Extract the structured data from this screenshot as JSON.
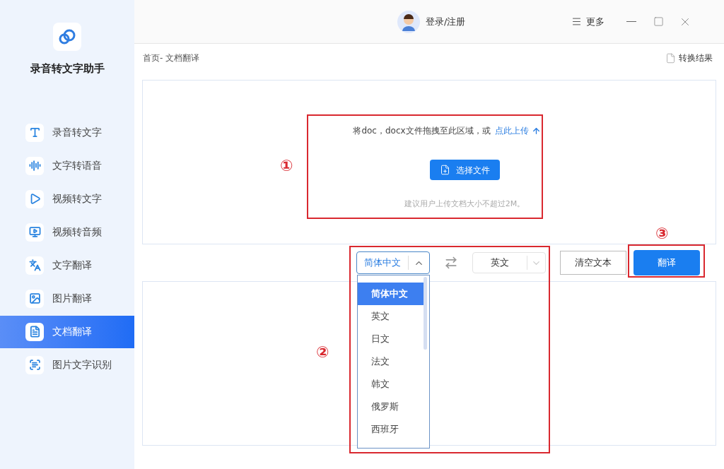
{
  "app": {
    "name": "录音转文字助手"
  },
  "sidebar": {
    "items": [
      {
        "label": "录音转文字",
        "selected": false
      },
      {
        "label": "文字转语音",
        "selected": false
      },
      {
        "label": "视频转文字",
        "selected": false
      },
      {
        "label": "视频转音频",
        "selected": false
      },
      {
        "label": "文字翻译",
        "selected": false
      },
      {
        "label": "图片翻译",
        "selected": false
      },
      {
        "label": "文档翻译",
        "selected": true
      },
      {
        "label": "图片文字识别",
        "selected": false
      }
    ]
  },
  "topbar": {
    "login": "登录/注册",
    "more": "更多"
  },
  "breadcrumb": "首页- 文档翻译",
  "results_link": "转换结果",
  "upload": {
    "prompt": "将doc，docx文件拖拽至此区域，或",
    "link": "点此上传",
    "button": "选择文件",
    "hint": "建议用户上传文档大小不超过2M。"
  },
  "source_language": {
    "value": "简体中文",
    "expanded": true,
    "options": [
      {
        "label": "简体中文",
        "selected": true
      },
      {
        "label": "英文",
        "selected": false
      },
      {
        "label": "日文",
        "selected": false
      },
      {
        "label": "法文",
        "selected": false
      },
      {
        "label": "韩文",
        "selected": false
      },
      {
        "label": "俄罗斯",
        "selected": false
      },
      {
        "label": "西班牙",
        "selected": false
      }
    ]
  },
  "target_language": {
    "value": "英文",
    "expanded": false
  },
  "clear_button": "清空文本",
  "translate_button": "翻译",
  "annotations": [
    "①",
    "②",
    "③"
  ]
}
